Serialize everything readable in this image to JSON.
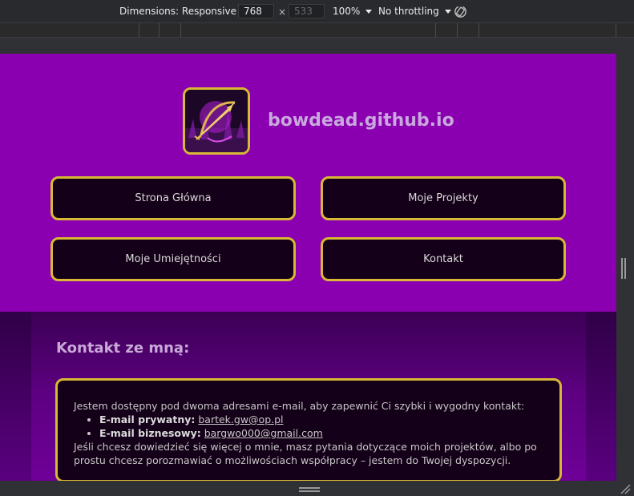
{
  "devtools": {
    "dimensions_label": "Dimensions: Responsive",
    "width_value": "768",
    "height_value": "533",
    "times_sign": "×",
    "zoom": "100%",
    "throttling": "No throttling"
  },
  "site": {
    "name": "bowdead.github.io",
    "nav": [
      {
        "label": "Strona Główna"
      },
      {
        "label": "Moje Projekty"
      },
      {
        "label": "Moje Umiejętności"
      },
      {
        "label": "Kontakt"
      }
    ]
  },
  "contact": {
    "title": "Kontakt ze mną:",
    "intro": "Jestem dostępny pod dwoma adresami e-mail, aby zapewnić Ci szybki i wygodny kontakt:",
    "private_label": "E-mail prywatny:",
    "private_email": "bartek.gw@op.pl",
    "business_label": "E-mail biznesowy:",
    "business_email": "bargwo000@gmail.com",
    "outro": "Jeśli chcesz dowiedzieć się więcej o mnie, masz pytania dotyczące moich projektów, albo po prostu chcesz porozmawiać o możliwościach współpracy – jestem do Twojej dyspozycji."
  },
  "colors": {
    "header_bg": "#8a00b0",
    "accent_border": "#d7b935",
    "button_bg": "#140018"
  }
}
